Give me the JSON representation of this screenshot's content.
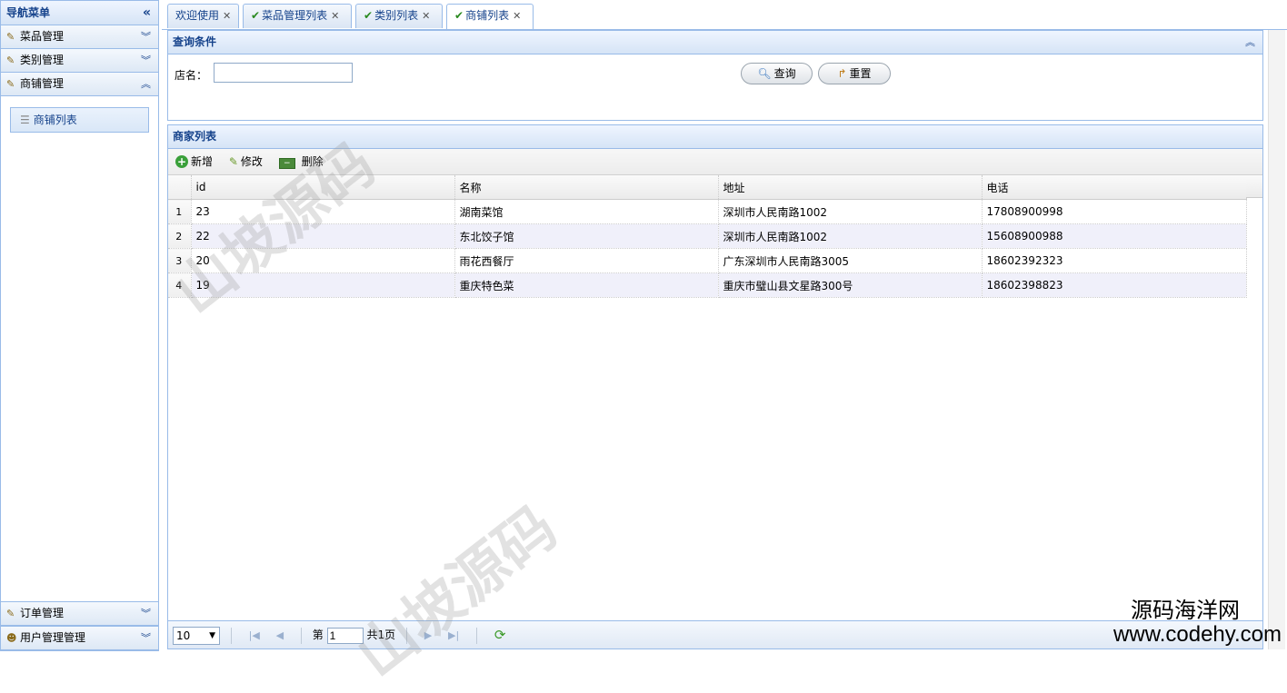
{
  "sidebar": {
    "title": "导航菜单",
    "collapse_icon": "«",
    "sections": [
      {
        "label": "菜品管理"
      },
      {
        "label": "类别管理"
      },
      {
        "label": "商铺管理"
      }
    ],
    "active_item": "商铺列表",
    "bottom_sections": [
      {
        "label": "订单管理"
      },
      {
        "label": "用户管理管理"
      }
    ]
  },
  "tabs": [
    {
      "label": "欢迎使用"
    },
    {
      "label": "菜品管理列表"
    },
    {
      "label": "类别列表"
    },
    {
      "label": "商铺列表"
    }
  ],
  "query": {
    "title": "查询条件",
    "field_label": "店名：",
    "field_value": "",
    "search_label": "查询",
    "reset_label": "重置"
  },
  "list": {
    "title": "商家列表",
    "toolbar": {
      "add": "新增",
      "edit": "修改",
      "delete": "删除"
    },
    "columns": [
      "id",
      "名称",
      "地址",
      "电话"
    ],
    "rows": [
      {
        "rn": "1",
        "id": "23",
        "name": "湖南菜馆",
        "address": "深圳市人民南路1002",
        "phone": "17808900998"
      },
      {
        "rn": "2",
        "id": "22",
        "name": "东北饺子馆",
        "address": "深圳市人民南路1002",
        "phone": "15608900988"
      },
      {
        "rn": "3",
        "id": "20",
        "name": "雨花西餐厅",
        "address": "广东深圳市人民南路3005",
        "phone": "18602392323"
      },
      {
        "rn": "4",
        "id": "19",
        "name": "重庆特色菜",
        "address": "重庆市璧山县文星路300号",
        "phone": "18602398823"
      }
    ]
  },
  "pager": {
    "page_size": "10",
    "page_prefix": "第",
    "page_value": "1",
    "page_total": "共1页"
  },
  "watermarks": {
    "text": "山坡源码",
    "corner_line1": "源码海洋网",
    "corner_line2": "www.codehy.com"
  }
}
